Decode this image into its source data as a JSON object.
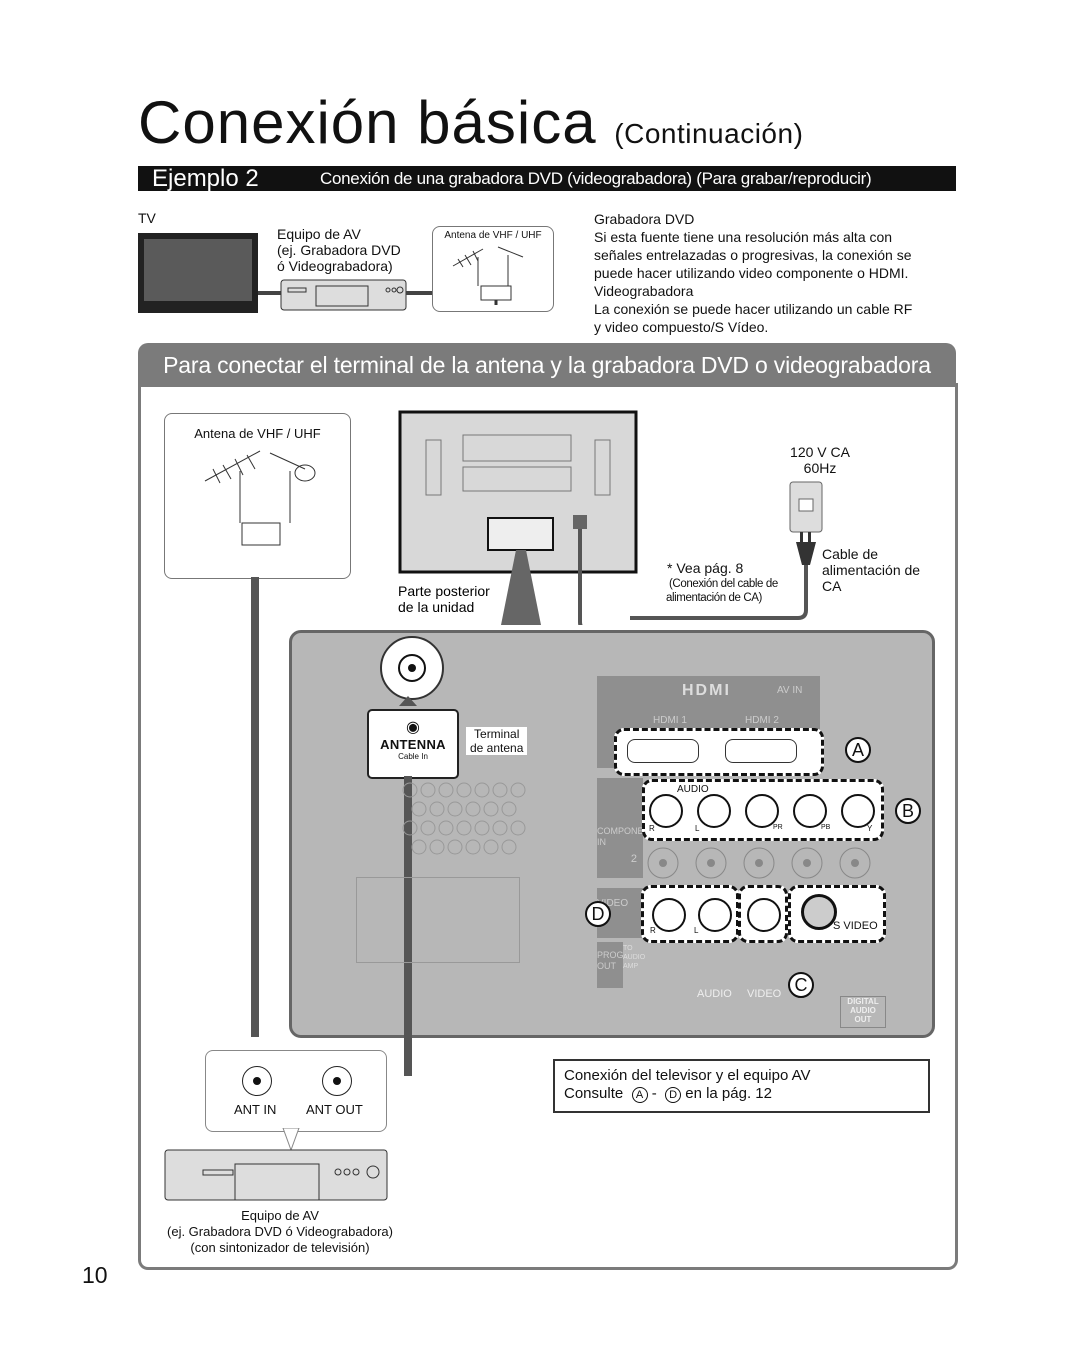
{
  "page": {
    "title": "Conexión básica",
    "title_suffix": "(Continuación)",
    "page_number": "10"
  },
  "example": {
    "label": "Ejemplo 2",
    "description": "Conexión de una grabadora DVD (videograbadora) (Para grabar/reproducir)"
  },
  "overview": {
    "tv_label": "TV",
    "av_equipment_lines": [
      "Equipo de AV",
      "(ej. Grabadora DVD",
      "ó Videograbadora)"
    ],
    "antenna_label": "Antena de VHF / UHF"
  },
  "notes": {
    "dvd_heading": "Grabadora DVD",
    "dvd_text_lines": [
      "Si esta fuente tiene una resolución más alta con",
      "señales entrelazadas o progresivas, la conexión se",
      "puede hacer utilizando video componente o HDMI."
    ],
    "vcr_heading": "Videograbadora",
    "vcr_text_lines": [
      "La conexión se puede hacer utilizando un cable RF",
      "y video compuesto/S Vídeo."
    ]
  },
  "section": {
    "header": "Para conectar el terminal de la antena y la grabadora DVD o videograbadora"
  },
  "diagram": {
    "antenna_label": "Antena de VHF / UHF",
    "rear_label_lines": [
      "Parte posterior",
      "de la unidad"
    ],
    "power_lines": [
      "120 V CA",
      "60Hz"
    ],
    "power_cable_lines": [
      "Cable de",
      "alimentación de",
      "CA"
    ],
    "see_page": "* Vea pág. 8",
    "see_page_note_lines": [
      "(Conexión del cable de",
      "alimentación de CA)"
    ],
    "antenna_terminal_label": "ANTENNA",
    "antenna_terminal_sub": "Cable  In",
    "terminal_caption_lines": [
      "Terminal",
      "de antena"
    ],
    "hdmi_logo": "HDMI",
    "av_in": "AV IN",
    "hdmi1": "HDMI 1",
    "hdmi2": "HDMI 2",
    "audio_label": "AUDIO",
    "component_lines": [
      "COMPONENT",
      "IN"
    ],
    "row1_jack_labels": [
      "R",
      "L",
      "PR",
      "PB",
      "Y"
    ],
    "row2_number": "2",
    "video_label": "VIDEO",
    "row3_jack_labels": [
      "R",
      "L"
    ],
    "s_video": "S VIDEO",
    "prog_out_lines": [
      "PROG",
      "OUT"
    ],
    "to_audio_amp_lines": [
      "TO",
      "AUDIO",
      "AMP"
    ],
    "bottom_audio": "AUDIO",
    "bottom_video": "VIDEO",
    "digital_audio_out_lines": [
      "DIGITAL",
      "AUDIO",
      "OUT"
    ],
    "callouts": [
      "A",
      "B",
      "C",
      "D"
    ],
    "ant_in": "ANT IN",
    "ant_out": "ANT OUT",
    "equipment_caption_lines": [
      "Equipo de AV",
      "(ej. Grabadora DVD ó Videograbadora)",
      "(con sintonizador de televisión)"
    ]
  },
  "reference": {
    "line1": "Conexión del televisor y el equipo AV",
    "consult": "Consulte",
    "from": "A",
    "dash": "-",
    "to": "D",
    "suffix": "en la pág. 12"
  }
}
